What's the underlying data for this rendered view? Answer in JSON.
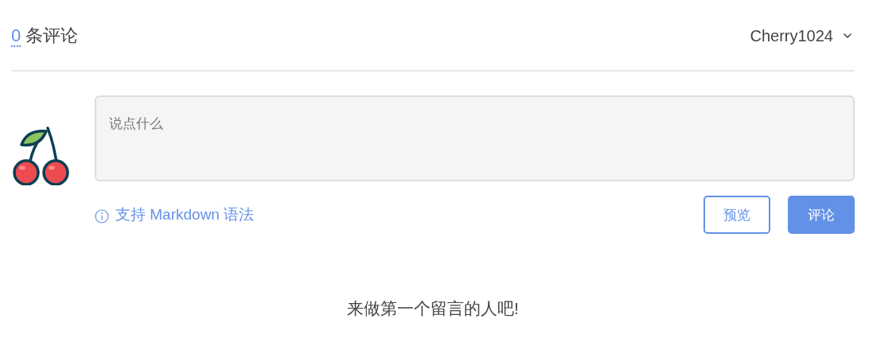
{
  "header": {
    "count": "0",
    "count_label": "条评论",
    "user": "Cherry1024"
  },
  "editor": {
    "placeholder": "说点什么",
    "hint": "支持 Markdown 语法"
  },
  "buttons": [
    {
      "label": "预览",
      "kind": "outline"
    },
    {
      "label": "评论",
      "kind": "primary"
    }
  ],
  "empty_message": "来做第一个留言的人吧!"
}
